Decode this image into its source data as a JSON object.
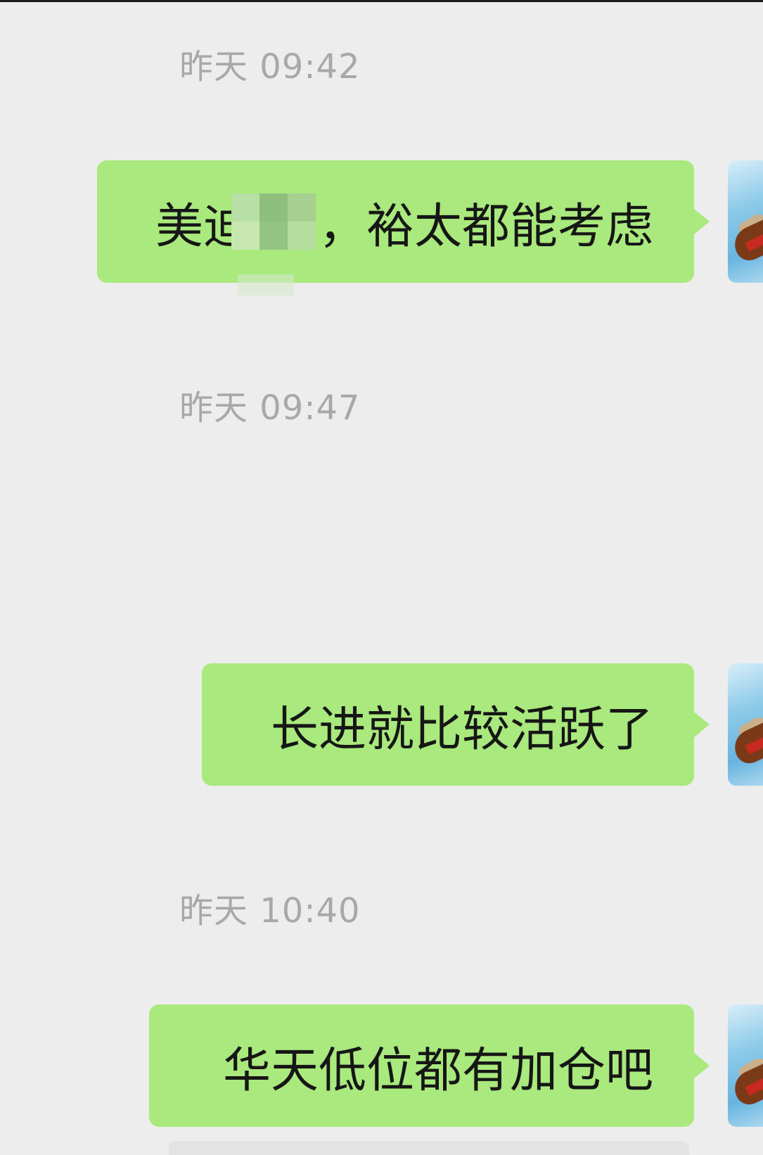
{
  "messages": [
    {
      "time": "昨天 09:42",
      "text_before": "美迪",
      "text_after": "，裕太都能考虑",
      "has_censor": true
    },
    {
      "time": "昨天 09:47",
      "text": "长进就比较活跃了"
    },
    {
      "time": "昨天 10:40",
      "text": "华天低位都有加仓吧"
    }
  ],
  "colors": {
    "background": "#ededed",
    "bubble_self": "#a9e97d",
    "timestamp": "#a8a8a8"
  },
  "icons": {
    "avatar": "user-avatar-boat-icon",
    "censor": "pixel-mosaic-censor"
  }
}
